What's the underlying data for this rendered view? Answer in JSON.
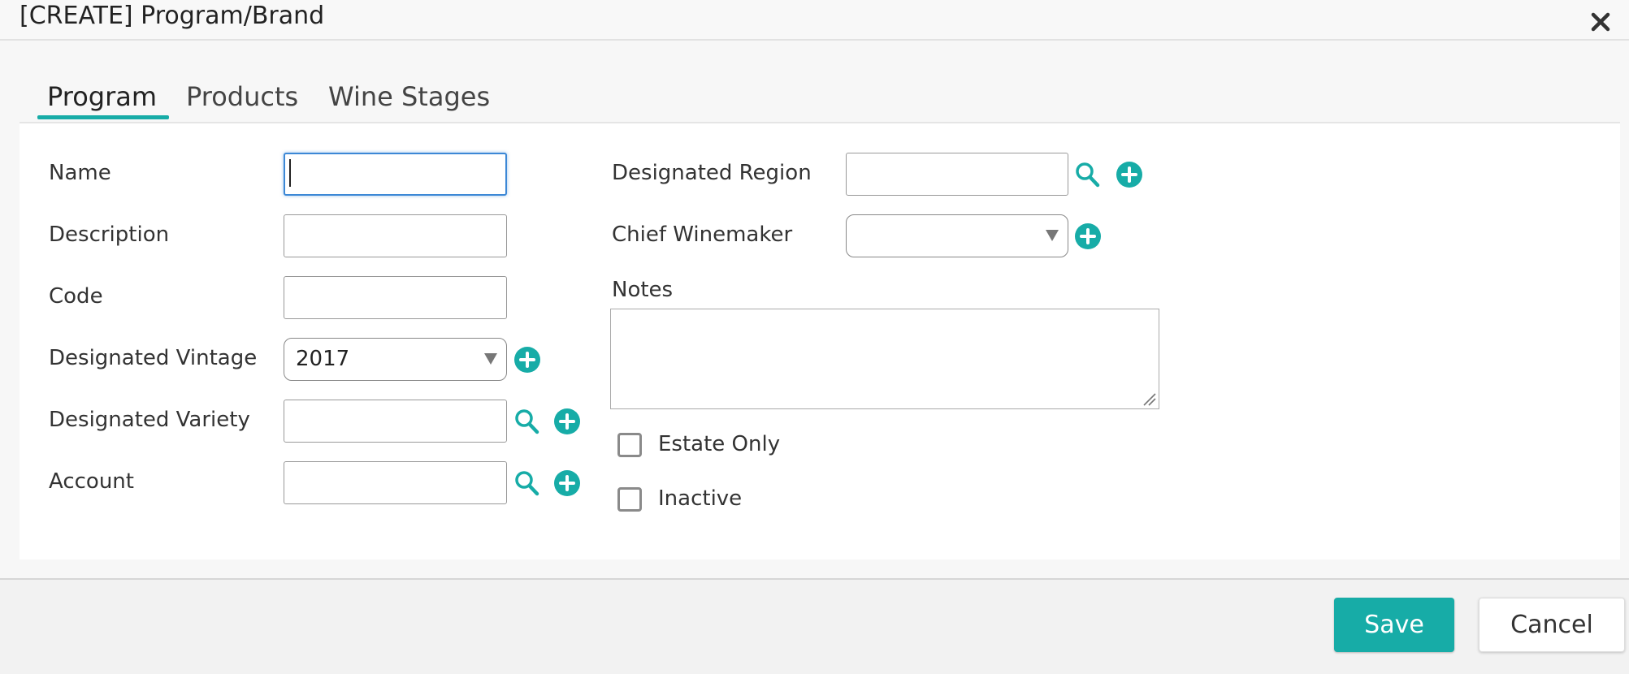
{
  "dialog": {
    "title": "[CREATE] Program/Brand"
  },
  "tabs": [
    {
      "label": "Program",
      "active": true
    },
    {
      "label": "Products",
      "active": false
    },
    {
      "label": "Wine Stages",
      "active": false
    }
  ],
  "form": {
    "name": {
      "label": "Name",
      "value": ""
    },
    "description": {
      "label": "Description",
      "value": ""
    },
    "code": {
      "label": "Code",
      "value": ""
    },
    "designated_vintage": {
      "label": "Designated Vintage",
      "value": "2017"
    },
    "designated_variety": {
      "label": "Designated Variety",
      "value": ""
    },
    "account": {
      "label": "Account",
      "value": ""
    },
    "designated_region": {
      "label": "Designated Region",
      "value": ""
    },
    "chief_winemaker": {
      "label": "Chief Winemaker",
      "value": ""
    },
    "notes": {
      "label": "Notes",
      "value": ""
    },
    "estate_only": {
      "label": "Estate Only",
      "checked": false
    },
    "inactive": {
      "label": "Inactive",
      "checked": false
    }
  },
  "footer": {
    "save_label": "Save",
    "cancel_label": "Cancel"
  },
  "colors": {
    "accent": "#17aca7",
    "focus": "#3c88d6"
  },
  "icons": {
    "search": "search-icon",
    "add": "plus-circle-icon",
    "close": "close-icon",
    "dropdown": "caret-down-icon"
  }
}
